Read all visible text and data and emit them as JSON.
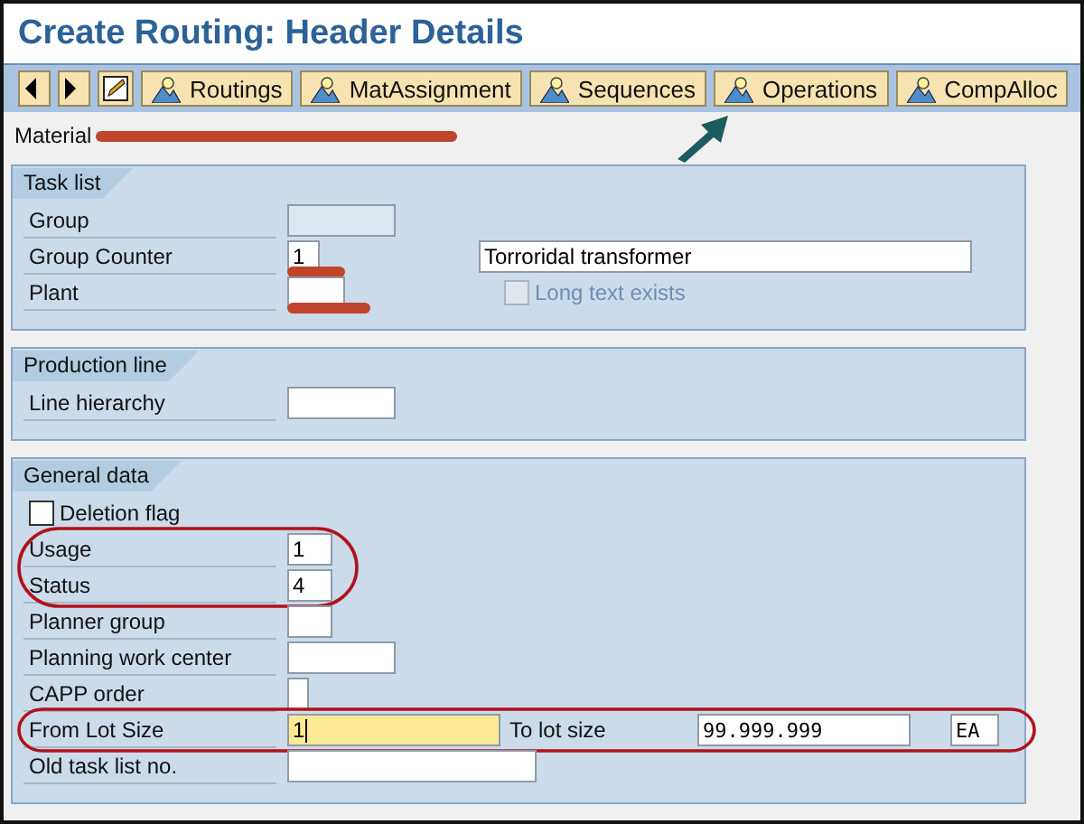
{
  "window": {
    "title": "Create Routing: Header Details"
  },
  "toolbar": {
    "buttons": [
      {
        "kind": "back"
      },
      {
        "kind": "forward"
      },
      {
        "kind": "edit"
      },
      {
        "kind": "text",
        "label": "Routings"
      },
      {
        "kind": "text",
        "label": "MatAssignment"
      },
      {
        "kind": "text",
        "label": "Sequences"
      },
      {
        "kind": "text",
        "label": "Operations",
        "pointed": true
      },
      {
        "kind": "text",
        "label": "CompAlloc"
      }
    ]
  },
  "material": {
    "label": "Material",
    "redacted": true
  },
  "sections": [
    {
      "title": "Task list",
      "rows": [
        {
          "kind": "field",
          "label": "Group",
          "value": "",
          "disabled": true
        },
        {
          "kind": "field",
          "label": "Group Counter",
          "value": "1",
          "disabled": false,
          "redacted": true,
          "extras": [
            {
              "kind": "field",
              "value": "Torroridal transformer"
            }
          ]
        },
        {
          "kind": "field",
          "label": "Plant",
          "value": "",
          "disabled": false,
          "redacted": true,
          "extras": [
            {
              "kind": "checkbox",
              "label": "Long text exists",
              "checked": false,
              "disabled": true
            }
          ]
        }
      ]
    },
    {
      "title": "Production line",
      "rows": [
        {
          "kind": "field",
          "label": "Line hierarchy",
          "value": "",
          "disabled": false
        }
      ]
    },
    {
      "title": "General data",
      "rows": [
        {
          "kind": "checkbox",
          "label": "Deletion flag",
          "checked": false
        },
        {
          "kind": "field",
          "label": "Usage",
          "value": "1",
          "disabled": false,
          "circled": true
        },
        {
          "kind": "field",
          "label": "Status",
          "value": "4",
          "disabled": false,
          "circled": true
        },
        {
          "kind": "field",
          "label": "Planner group",
          "value": "",
          "disabled": false
        },
        {
          "kind": "field",
          "label": "Planning work center",
          "value": "",
          "disabled": false
        },
        {
          "kind": "field",
          "label": "CAPP order",
          "value": "",
          "disabled": false
        },
        {
          "kind": "field",
          "label": "From Lot Size",
          "value": "1",
          "disabled": false,
          "focused": true,
          "circled": true,
          "extras": [
            {
              "kind": "label",
              "text": "To lot size"
            },
            {
              "kind": "field",
              "value": "99.999.999"
            },
            {
              "kind": "field",
              "value": "EA"
            }
          ]
        },
        {
          "kind": "field",
          "label": "Old task list no.",
          "value": "",
          "disabled": false
        }
      ]
    }
  ]
}
